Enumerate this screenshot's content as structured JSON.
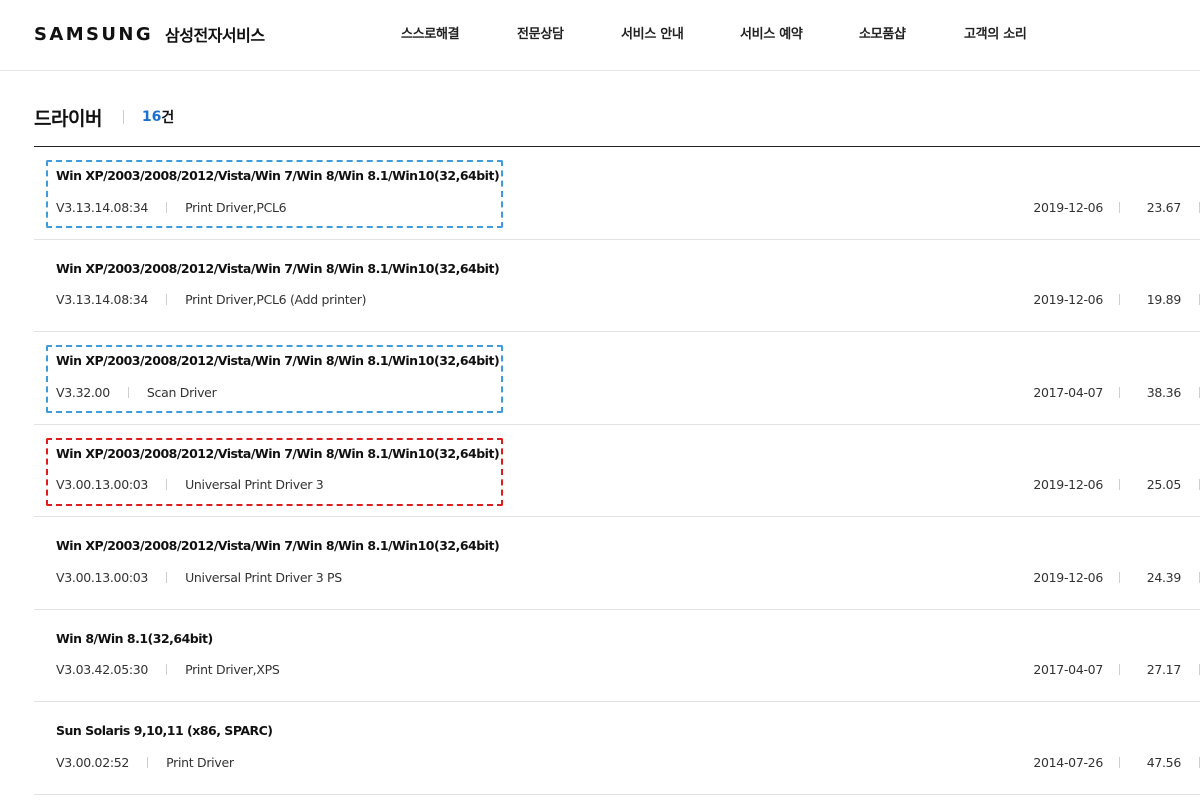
{
  "header": {
    "brand": "SAMSUNG",
    "service_name": "삼성전자서비스",
    "nav": [
      {
        "label": "스스로해결"
      },
      {
        "label": "전문상담"
      },
      {
        "label": "서비스 안내"
      },
      {
        "label": "서비스 예약"
      },
      {
        "label": "소모품샵"
      },
      {
        "label": "고객의 소리"
      }
    ]
  },
  "section": {
    "title": "드라이버",
    "count": "16",
    "count_unit": "건"
  },
  "highlight_colors": {
    "blue": "#3d9cdd",
    "red": "#e01b1b"
  },
  "accent_color": "#1a6fce",
  "drivers": [
    {
      "os": "Win XP/2003/2008/2012/Vista/Win 7/Win 8/Win 8.1/Win10(32,64bit)",
      "version": "V3.13.14.08:34",
      "type": "Print Driver,PCL6",
      "date": "2019-12-06",
      "size": "23.67",
      "highlight": "blue"
    },
    {
      "os": "Win XP/2003/2008/2012/Vista/Win 7/Win 8/Win 8.1/Win10(32,64bit)",
      "version": "V3.13.14.08:34",
      "type": "Print Driver,PCL6 (Add printer)",
      "date": "2019-12-06",
      "size": "19.89",
      "highlight": ""
    },
    {
      "os": "Win XP/2003/2008/2012/Vista/Win 7/Win 8/Win 8.1/Win10(32,64bit)",
      "version": "V3.32.00",
      "type": "Scan Driver",
      "date": "2017-04-07",
      "size": "38.36",
      "highlight": "blue"
    },
    {
      "os": "Win XP/2003/2008/2012/Vista/Win 7/Win 8/Win 8.1/Win10(32,64bit)",
      "version": "V3.00.13.00:03",
      "type": "Universal Print Driver 3",
      "date": "2019-12-06",
      "size": "25.05",
      "highlight": "red"
    },
    {
      "os": "Win XP/2003/2008/2012/Vista/Win 7/Win 8/Win 8.1/Win10(32,64bit)",
      "version": "V3.00.13.00:03",
      "type": "Universal Print Driver 3 PS",
      "date": "2019-12-06",
      "size": "24.39",
      "highlight": ""
    },
    {
      "os": "Win 8/Win 8.1(32,64bit)",
      "version": "V3.03.42.05:30",
      "type": "Print Driver,XPS",
      "date": "2017-04-07",
      "size": "27.17",
      "highlight": ""
    },
    {
      "os": "Sun Solaris 9,10,11 (x86, SPARC)",
      "version": "V3.00.02:52",
      "type": "Print Driver",
      "date": "2014-07-26",
      "size": "47.56",
      "highlight": ""
    }
  ]
}
